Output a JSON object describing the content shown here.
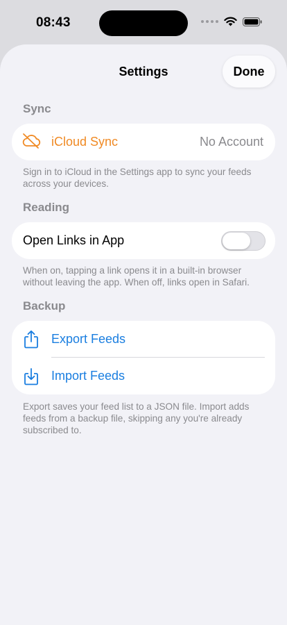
{
  "status_bar": {
    "time": "08:43"
  },
  "nav": {
    "title": "Settings",
    "done_label": "Done"
  },
  "sync": {
    "header": "Sync",
    "row": {
      "label": "iCloud Sync",
      "value": "No Account",
      "icon": "cloud-slash-icon",
      "color": "#f08a24"
    },
    "footer": "Sign in to iCloud in the Settings app to sync your feeds across your devices."
  },
  "reading": {
    "header": "Reading",
    "row": {
      "label": "Open Links in App",
      "toggle_on": false
    },
    "footer": "When on, tapping a link opens it in a built-in browser without leaving the app. When off, links open in Safari."
  },
  "backup": {
    "header": "Backup",
    "rows": [
      {
        "label": "Export Feeds",
        "icon": "share-export-icon"
      },
      {
        "label": "Import Feeds",
        "icon": "tray-import-icon"
      }
    ],
    "footer": "Export saves your feed list to a JSON file. Import adds feeds from a backup file, skipping any you're already subscribed to.",
    "accent": "#1a7ee0"
  }
}
